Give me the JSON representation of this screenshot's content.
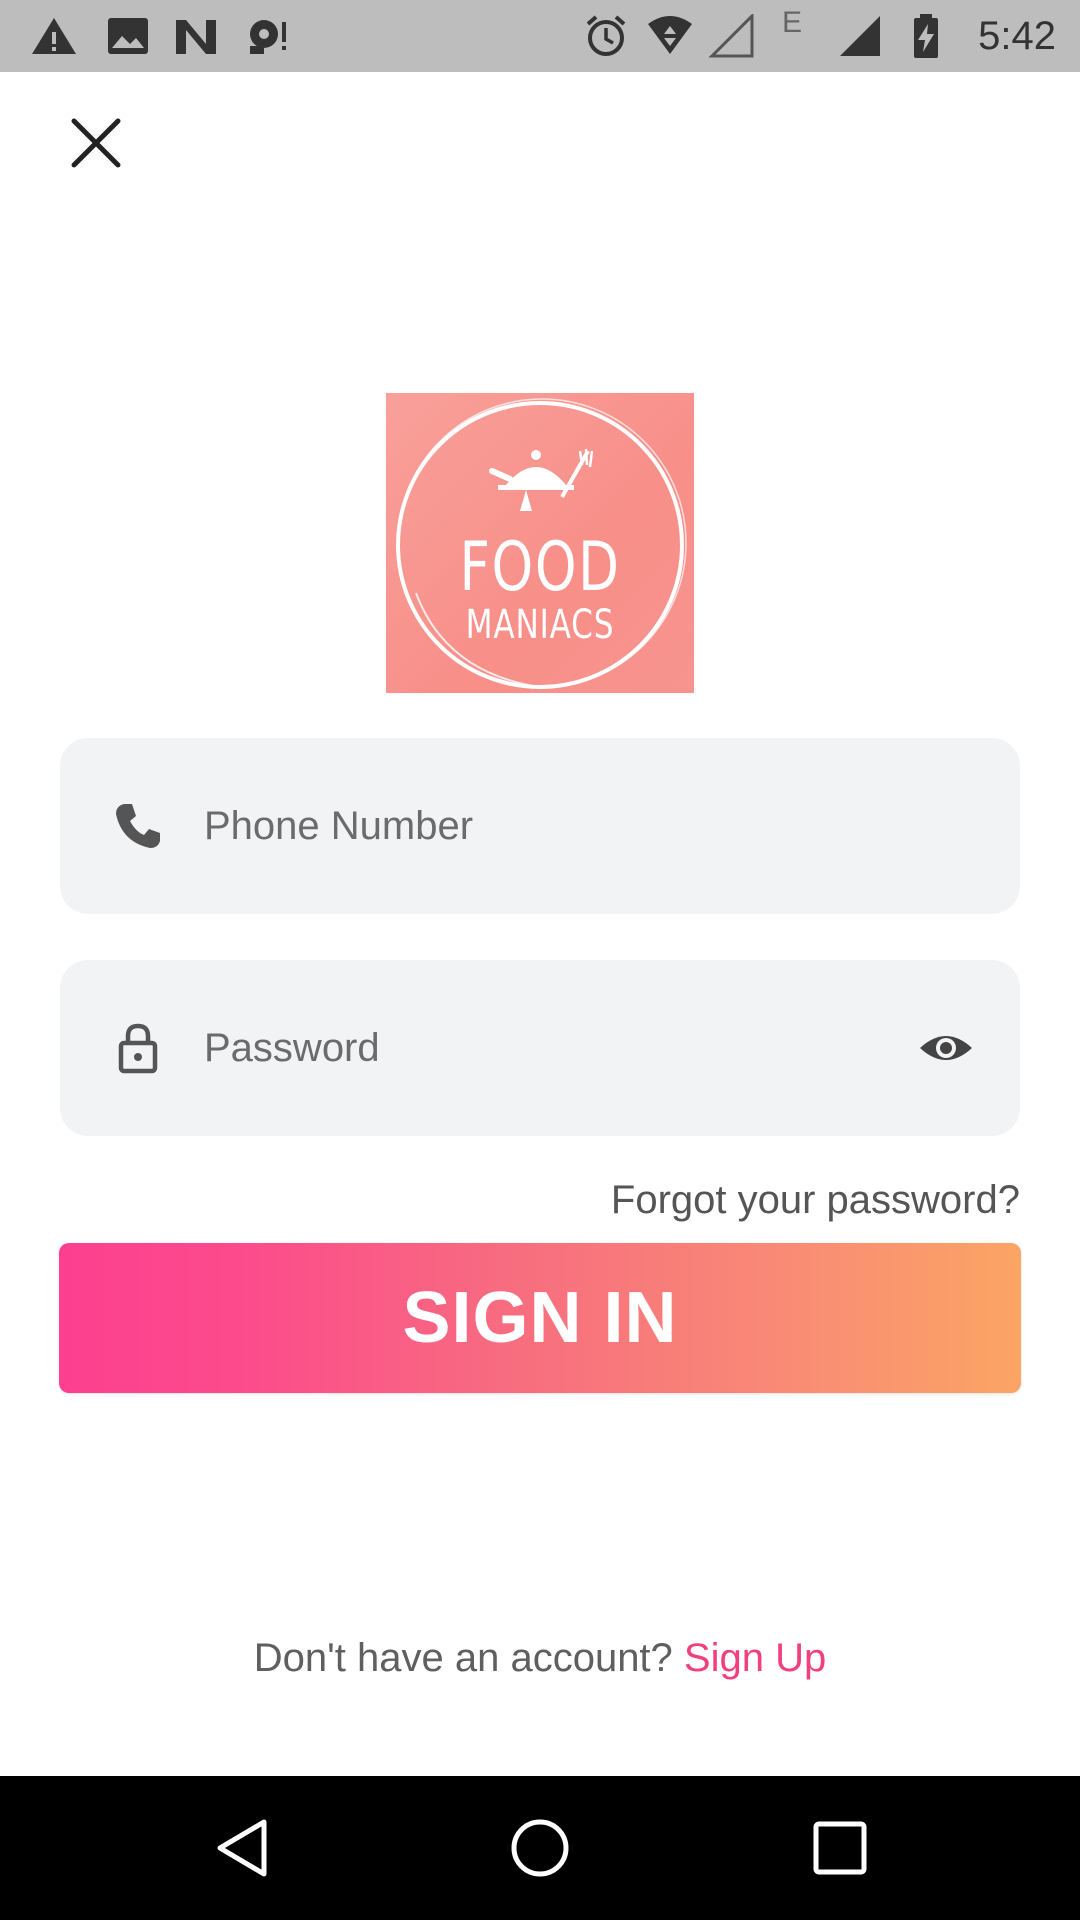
{
  "status_bar": {
    "time": "5:42",
    "network_letter": "E",
    "icons": [
      "warning-icon",
      "image-icon",
      "n-icon",
      "record-icon",
      "alarm-icon",
      "wifi-icon",
      "signal-empty-icon",
      "signal-icon",
      "battery-charging-icon"
    ]
  },
  "logo": {
    "line1": "FOOD",
    "line2": "MANIACS",
    "bg_color": "#f8948e"
  },
  "form": {
    "phone_placeholder": "Phone Number",
    "phone_value": "",
    "password_placeholder": "Password",
    "password_value": "",
    "forgot_label": "Forgot your password?",
    "signin_label": "SIGN IN"
  },
  "footer": {
    "prompt": "Don't have an account?",
    "signup_label": "Sign Up"
  },
  "colors": {
    "accent": "#f2407f",
    "gradient_start": "#fc408f",
    "gradient_end": "#fba564",
    "field_bg": "#f2f3f5"
  }
}
